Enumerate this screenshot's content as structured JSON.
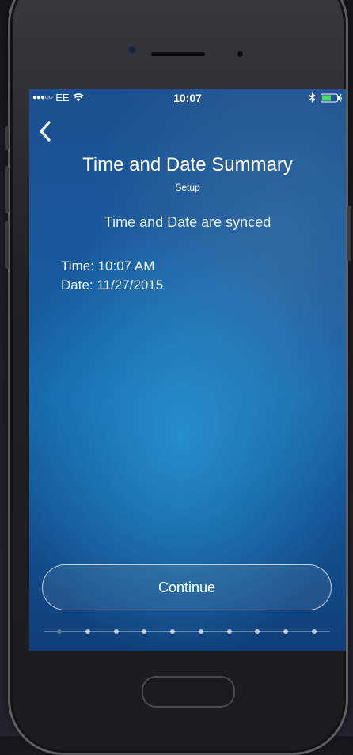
{
  "status_bar": {
    "carrier": "EE",
    "time": "10:07"
  },
  "header": {
    "title": "Time and Date Summary",
    "subtitle": "Setup"
  },
  "main": {
    "status_message": "Time and Date are synced",
    "time_line": "Time: 10:07 AM",
    "date_line": "Date: 11/27/2015"
  },
  "footer": {
    "continue_label": "Continue",
    "progress_steps_total": 10,
    "progress_current_step": 1
  },
  "colors": {
    "screen_background": "#1565a8",
    "text": "#ffffff",
    "progress_active": "#5a7a9a"
  },
  "icons": [
    "signal-icon",
    "wifi-icon",
    "bluetooth-icon",
    "battery-icon",
    "back-arrow-icon"
  ]
}
